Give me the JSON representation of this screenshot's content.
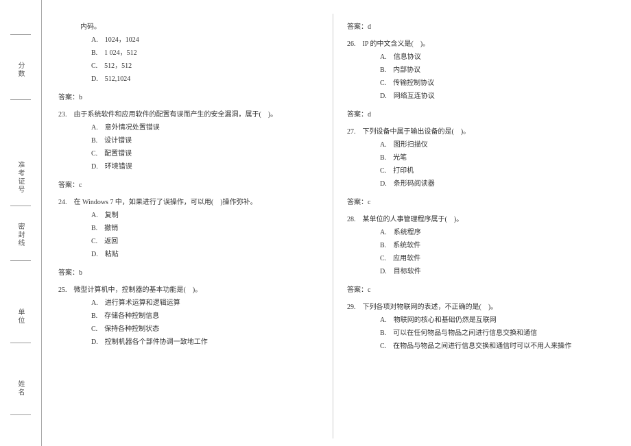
{
  "margin": {
    "labels": [
      "分数",
      "准考证号",
      "密封线",
      "单位",
      "姓名"
    ]
  },
  "left": {
    "pre_stem": "内码。",
    "q22_opts": {
      "A": "1024，1024",
      "B": "1 024，512",
      "C": "512，512",
      "D": "512,1024"
    },
    "q22_ans": "答案：b",
    "q23": "23.　由于系统软件和应用软件的配置有误而产生的安全漏洞，属于(　)。",
    "q23_opts": {
      "A": "意外情况处置错误",
      "B": "设计错误",
      "C": "配置错误",
      "D": "环境错误"
    },
    "q23_ans": "答案：c",
    "q24": "24.　在 Windows 7 中，如果进行了误操作，可以用(　)操作弥补。",
    "q24_opts": {
      "A": "复制",
      "B": "撤销",
      "C": "返回",
      "D": "粘贴"
    },
    "q24_ans": "答案：b",
    "q25": "25.　微型计算机中，控制器的基本功能是(　)。",
    "q25_opts": {
      "A": "进行算术运算和逻辑运算",
      "B": "存储各种控制信息",
      "C": "保持各种控制状态",
      "D": "控制机器各个部件协调一致地工作"
    }
  },
  "right": {
    "q25_ans": "答案：d",
    "q26": "26.　IP 的中文含义是(　)。",
    "q26_opts": {
      "A": "信息协议",
      "B": "内部协议",
      "C": "传输控制协议",
      "D": "网络互连协议"
    },
    "q26_ans": "答案：d",
    "q27": "27.　下列设备中属于输出设备的是(　)。",
    "q27_opts": {
      "A": "图形扫描仪",
      "B": "光笔",
      "C": "打印机",
      "D": "条形码阅读器"
    },
    "q27_ans": "答案：c",
    "q28": "28.　某单位的人事管理程序属于(　)。",
    "q28_opts": {
      "A": "系统程序",
      "B": "系统软件",
      "C": "应用软件",
      "D": "目标软件"
    },
    "q28_ans": "答案：c",
    "q29": "29.　下列各项对物联网的表述，不正确的是(　)。",
    "q29_opts": {
      "A": "物联网的核心和基础仍然是互联网",
      "B": "可以在任何物品与物品之间进行信息交换和通信",
      "C": "在物品与物品之间进行信息交换和通信时可以不用人来操作"
    }
  }
}
